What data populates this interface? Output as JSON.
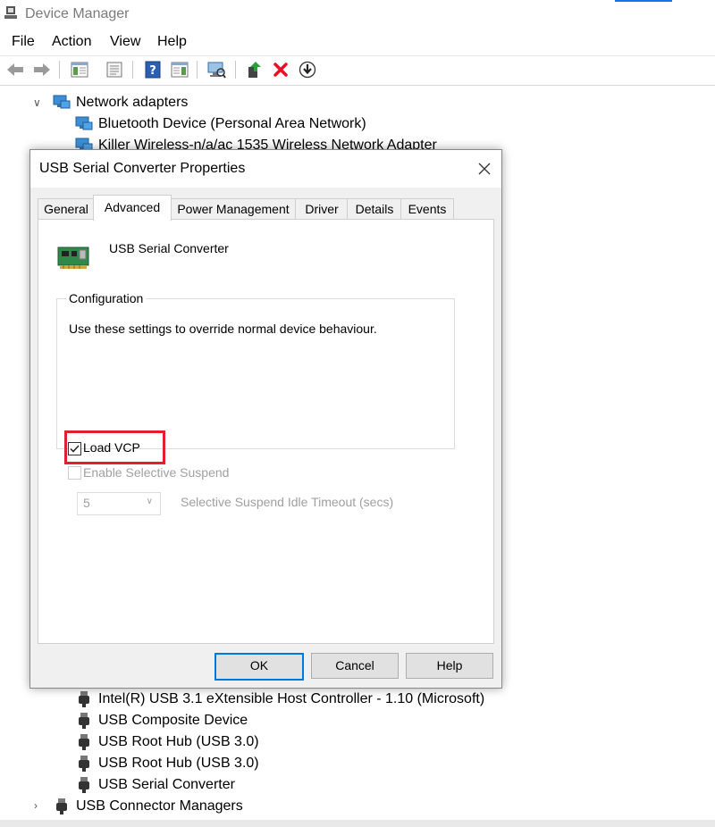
{
  "window": {
    "title": "Device Manager"
  },
  "menu": [
    "File",
    "Action",
    "View",
    "Help"
  ],
  "tree": {
    "top": [
      {
        "label": "Network adapters",
        "icon": "network-adapter-icon",
        "expanded": true
      },
      {
        "label": "Bluetooth Device (Personal Area Network)",
        "icon": "network-adapter-icon"
      },
      {
        "label": "Killer Wireless-n/a/ac 1535 Wireless Network Adapter",
        "icon": "network-adapter-icon"
      }
    ],
    "bottom": [
      {
        "label": "Intel(R) USB 3.1 eXtensible Host Controller - 1.10 (Microsoft)",
        "icon": "usb-plug-icon"
      },
      {
        "label": "USB Composite Device",
        "icon": "usb-plug-icon"
      },
      {
        "label": "USB Root Hub (USB 3.0)",
        "icon": "usb-plug-icon"
      },
      {
        "label": "USB Root Hub (USB 3.0)",
        "icon": "usb-plug-icon"
      },
      {
        "label": "USB Serial Converter",
        "icon": "usb-plug-icon"
      },
      {
        "label": "USB Connector Managers",
        "icon": "usb-plug-icon",
        "expanded": false
      }
    ]
  },
  "dialog": {
    "title": "USB Serial Converter Properties",
    "tabs": [
      "General",
      "Advanced",
      "Power Management",
      "Driver",
      "Details",
      "Events"
    ],
    "active_tab": "Advanced",
    "device_name": "USB Serial Converter",
    "group_title": "Configuration",
    "description": "Use these settings to override normal device behaviour.",
    "load_vcp": {
      "label": "Load VCP",
      "checked": true
    },
    "selective_suspend": {
      "label": "Enable Selective Suspend",
      "checked": false,
      "enabled": false
    },
    "idle_timeout": {
      "value": "5",
      "label": "Selective Suspend Idle Timeout (secs)",
      "enabled": false
    },
    "buttons": {
      "ok": "OK",
      "cancel": "Cancel",
      "help": "Help"
    }
  },
  "colors": {
    "highlight": "#e02030",
    "accent": "#0078d7",
    "delete_icon": "#e81123",
    "update_icon": "#2e7d32"
  }
}
